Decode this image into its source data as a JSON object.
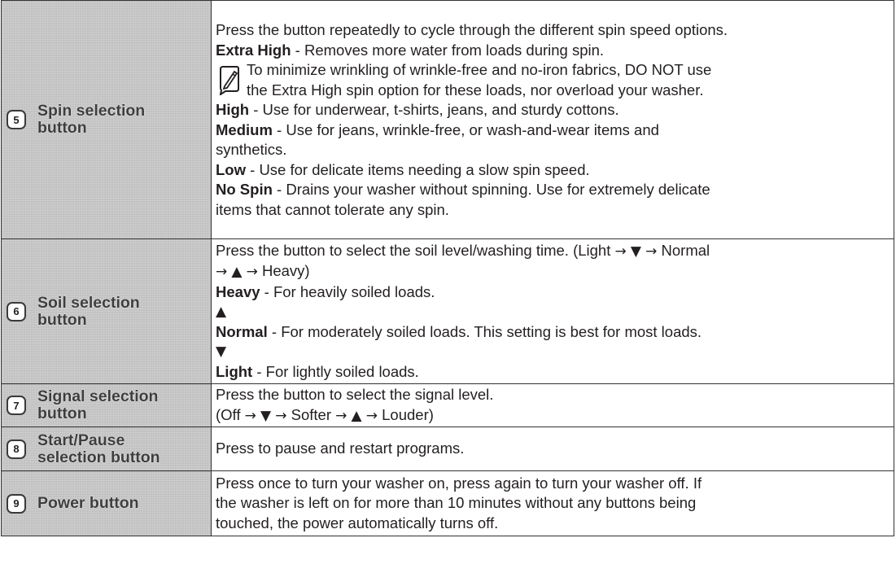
{
  "rows": [
    {
      "number": "5",
      "label_lines": [
        "Spin selection",
        "button"
      ],
      "lines": {
        "intro": "Press the button repeatedly to cycle through the different spin speed options.",
        "extra_high_term": "Extra High",
        "extra_high_text": " - Removes more water from loads during spin.",
        "note_line1": "To minimize wrinkling of wrinkle-free and no-iron fabrics, DO NOT use",
        "note_line2": "the Extra High spin option for these loads, nor overload your washer.",
        "high_term": "High",
        "high_text": " - Use for underwear, t-shirts, jeans, and sturdy cottons.",
        "medium_term": "Medium",
        "medium_text": " - Use for jeans, wrinkle-free, or wash-and-wear items and",
        "medium_cont": "synthetics.",
        "low_term": "Low",
        "low_text": " - Use for delicate items needing a slow spin speed.",
        "nospin_term": "No Spin",
        "nospin_text": " - Drains your washer without spinning. Use for extremely delicate",
        "nospin_cont": "items that cannot tolerate any spin."
      }
    },
    {
      "number": "6",
      "label_lines": [
        "Soil selection",
        "button"
      ],
      "lines": {
        "intro_a": "Press the button to select the soil level/washing time. (Light ",
        "arrow1": "→",
        "down1": "▼",
        "arrow2": "→",
        "intro_b": " Normal",
        "arrow3": "→",
        "up1": "▲",
        "arrow4": "→",
        "intro_c": " Heavy)",
        "heavy_term": "Heavy",
        "heavy_text": " - For heavily soiled loads.",
        "up2": "▲",
        "normal_term": "Normal",
        "normal_text": " - For moderately soiled loads. This setting is best for most loads.",
        "down2": "▼",
        "light_term": "Light",
        "light_text": " - For lightly soiled loads."
      }
    },
    {
      "number": "7",
      "label_lines": [
        "Signal selection",
        "button"
      ],
      "lines": {
        "intro": "Press the button to select the signal level.",
        "seq_a": "(Off ",
        "arrow1": "→",
        "down": "▼",
        "arrow2": "→",
        "seq_b": " Softer ",
        "arrow3": "→",
        "up": "▲",
        "arrow4": "→",
        "seq_c": " Louder)"
      }
    },
    {
      "number": "8",
      "label_lines": [
        "Start/Pause",
        "selection button"
      ],
      "lines": {
        "intro": "Press to pause and restart programs."
      }
    },
    {
      "number": "9",
      "label_lines": [
        "Power button"
      ],
      "lines": {
        "l1": "Press once to turn your washer on, press again to turn your washer off. If",
        "l2": "the washer is left on for more than 10 minutes without any buttons being",
        "l3": "touched, the power automatically turns off."
      }
    }
  ],
  "icons": {
    "note": "pencil-note-icon"
  },
  "colors": {
    "label_background": "#cfcfcf",
    "border": "#333333",
    "text": "#231f20"
  }
}
